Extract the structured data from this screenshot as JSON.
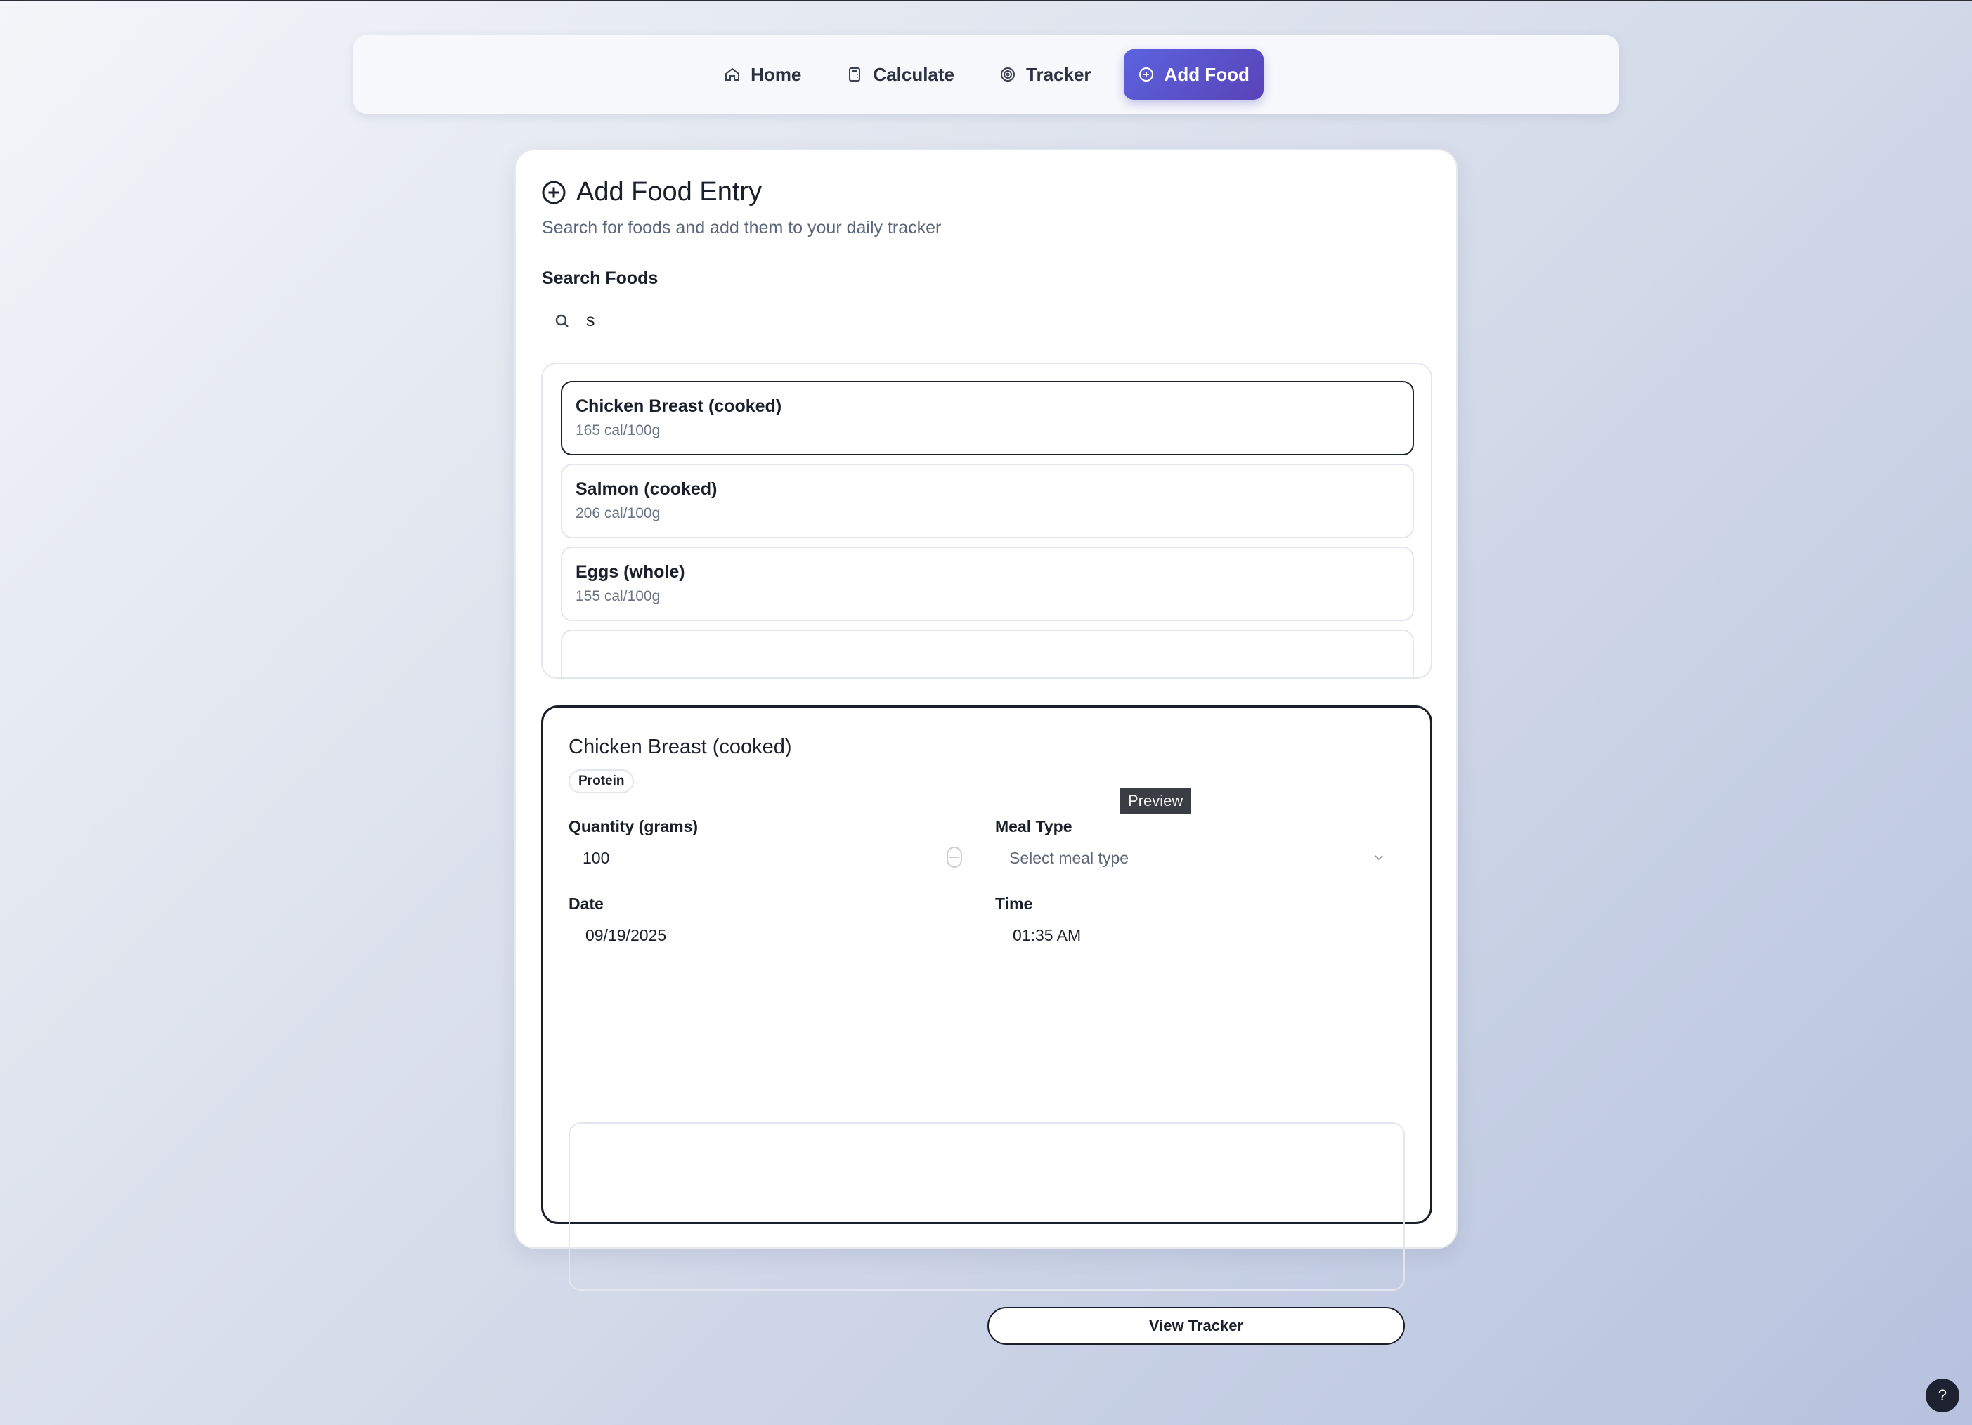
{
  "nav": {
    "items": [
      {
        "label": "Home",
        "icon": "home-icon"
      },
      {
        "label": "Calculate",
        "icon": "calculator-icon"
      },
      {
        "label": "Tracker",
        "icon": "target-icon"
      },
      {
        "label": "Add Food",
        "icon": "plus-circle-icon",
        "active": true
      }
    ]
  },
  "page": {
    "title": "Add Food Entry",
    "subtitle": "Search for foods and add them to your daily tracker"
  },
  "search": {
    "label": "Search Foods",
    "value": "s"
  },
  "results": [
    {
      "name": "Chicken Breast (cooked)",
      "calories": "165 cal/100g"
    },
    {
      "name": "Salmon (cooked)",
      "calories": "206 cal/100g"
    },
    {
      "name": "Eggs (whole)",
      "calories": "155 cal/100g"
    }
  ],
  "detail": {
    "food_name": "Chicken Breast (cooked)",
    "category": "Protein",
    "tooltip": "Preview",
    "quantity_label": "Quantity (grams)",
    "quantity_value": "100",
    "meal_type_label": "Meal Type",
    "meal_type_placeholder": "Select meal type",
    "date_label": "Date",
    "date_value": "09/19/2025",
    "time_label": "Time",
    "time_value": "01:35 AM",
    "view_tracker": "View Tracker"
  },
  "help": "?",
  "colors": {
    "accent": "#5b63df",
    "accent_dark": "#5a43b7"
  }
}
